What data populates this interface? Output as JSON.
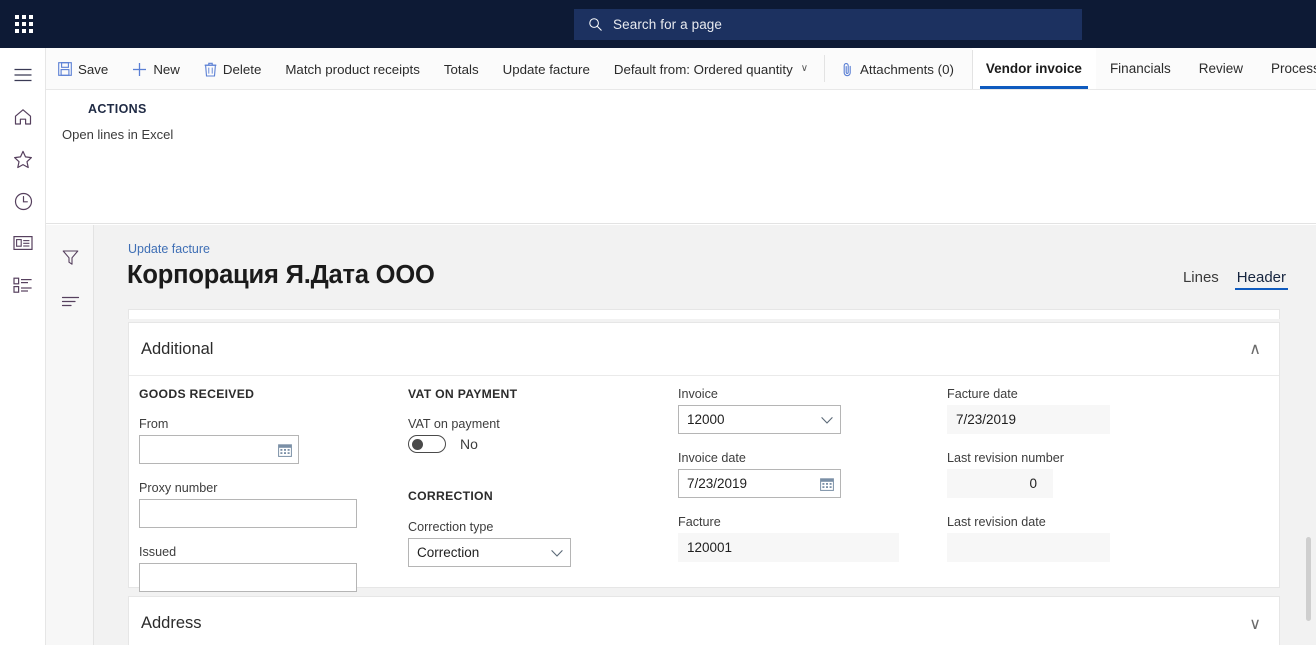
{
  "header": {
    "waffle_name": "app-launcher",
    "search": {
      "placeholder": "Search for a page",
      "icon": "search-icon"
    },
    "bar_color": "#0d1a35",
    "search_bg": "#1c3160"
  },
  "rail": {
    "items": [
      {
        "name": "hamburger-icon",
        "label": "Expand the navigation pane"
      },
      {
        "name": "home-icon",
        "label": "Home"
      },
      {
        "name": "star-icon",
        "label": "Favorites"
      },
      {
        "name": "clock-icon",
        "label": "Recent"
      },
      {
        "name": "workspace-icon",
        "label": "Workspaces"
      },
      {
        "name": "modules-icon",
        "label": "Modules"
      }
    ]
  },
  "commandbar": {
    "buttons": [
      {
        "label": "Save",
        "icon": "save-icon"
      },
      {
        "label": "New",
        "icon": "plus-icon"
      },
      {
        "label": "Delete",
        "icon": "trash-icon"
      },
      {
        "label": "Match product receipts",
        "icon": ""
      },
      {
        "label": "Totals",
        "icon": ""
      },
      {
        "label": "Update facture",
        "icon": ""
      },
      {
        "label": "Default from: Ordered quantity",
        "icon": "",
        "caret": "∨"
      },
      {
        "label": "Attachments (0)",
        "icon": "paperclip-icon"
      }
    ],
    "tabs": [
      {
        "label": "Vendor invoice",
        "active": true
      },
      {
        "label": "Financials",
        "active": false
      },
      {
        "label": "Review",
        "active": false
      },
      {
        "label": "Process",
        "active": false
      }
    ],
    "active_tab_underline": "#0f5bbf"
  },
  "actionpane": {
    "group_title": "ACTIONS",
    "links": [
      {
        "label": "Open lines in Excel"
      }
    ]
  },
  "filterstrip": {
    "buttons": [
      {
        "name": "filter-funnel-icon",
        "label": "Show filters"
      },
      {
        "name": "show-list-icon",
        "label": "Show list"
      }
    ]
  },
  "page": {
    "breadcrumb": "Update facture",
    "title": "Корпорация Я.Дата ООО",
    "viewtabs": [
      {
        "label": "Lines",
        "active": false
      },
      {
        "label": "Header",
        "active": true
      }
    ]
  },
  "panels": [
    {
      "title": "Additional",
      "expanded": true,
      "chevron": "∧"
    },
    {
      "title": "Address",
      "expanded": false,
      "chevron": "∨"
    }
  ],
  "form": {
    "col1": {
      "group": "GOODS RECEIVED",
      "fields": [
        {
          "label": "From",
          "value": "",
          "type": "date",
          "icon": "calendar-icon"
        },
        {
          "label": "Proxy number",
          "value": "",
          "type": "text"
        },
        {
          "label": "Issued",
          "value": "",
          "type": "text"
        }
      ]
    },
    "col2": {
      "group1": "VAT ON PAYMENT",
      "toggle": {
        "label": "VAT on payment",
        "value": "No",
        "on": false
      },
      "group2": "CORRECTION",
      "select": {
        "label": "Correction type",
        "value": "Correction",
        "chevron": "∨"
      }
    },
    "col3": {
      "fields": [
        {
          "label": "Invoice",
          "value": "12000",
          "type": "combo",
          "icon": "chevron-down-icon"
        },
        {
          "label": "Invoice date",
          "value": "7/23/2019",
          "type": "date",
          "icon": "calendar-icon"
        },
        {
          "label": "Facture",
          "value": "120001",
          "type": "readonly"
        }
      ]
    },
    "col4": {
      "fields": [
        {
          "label": "Facture date",
          "value": "7/23/2019",
          "type": "readonly"
        },
        {
          "label": "Last revision number",
          "value": "0",
          "type": "readonly-number"
        },
        {
          "label": "Last revision date",
          "value": "",
          "type": "readonly"
        }
      ]
    }
  }
}
